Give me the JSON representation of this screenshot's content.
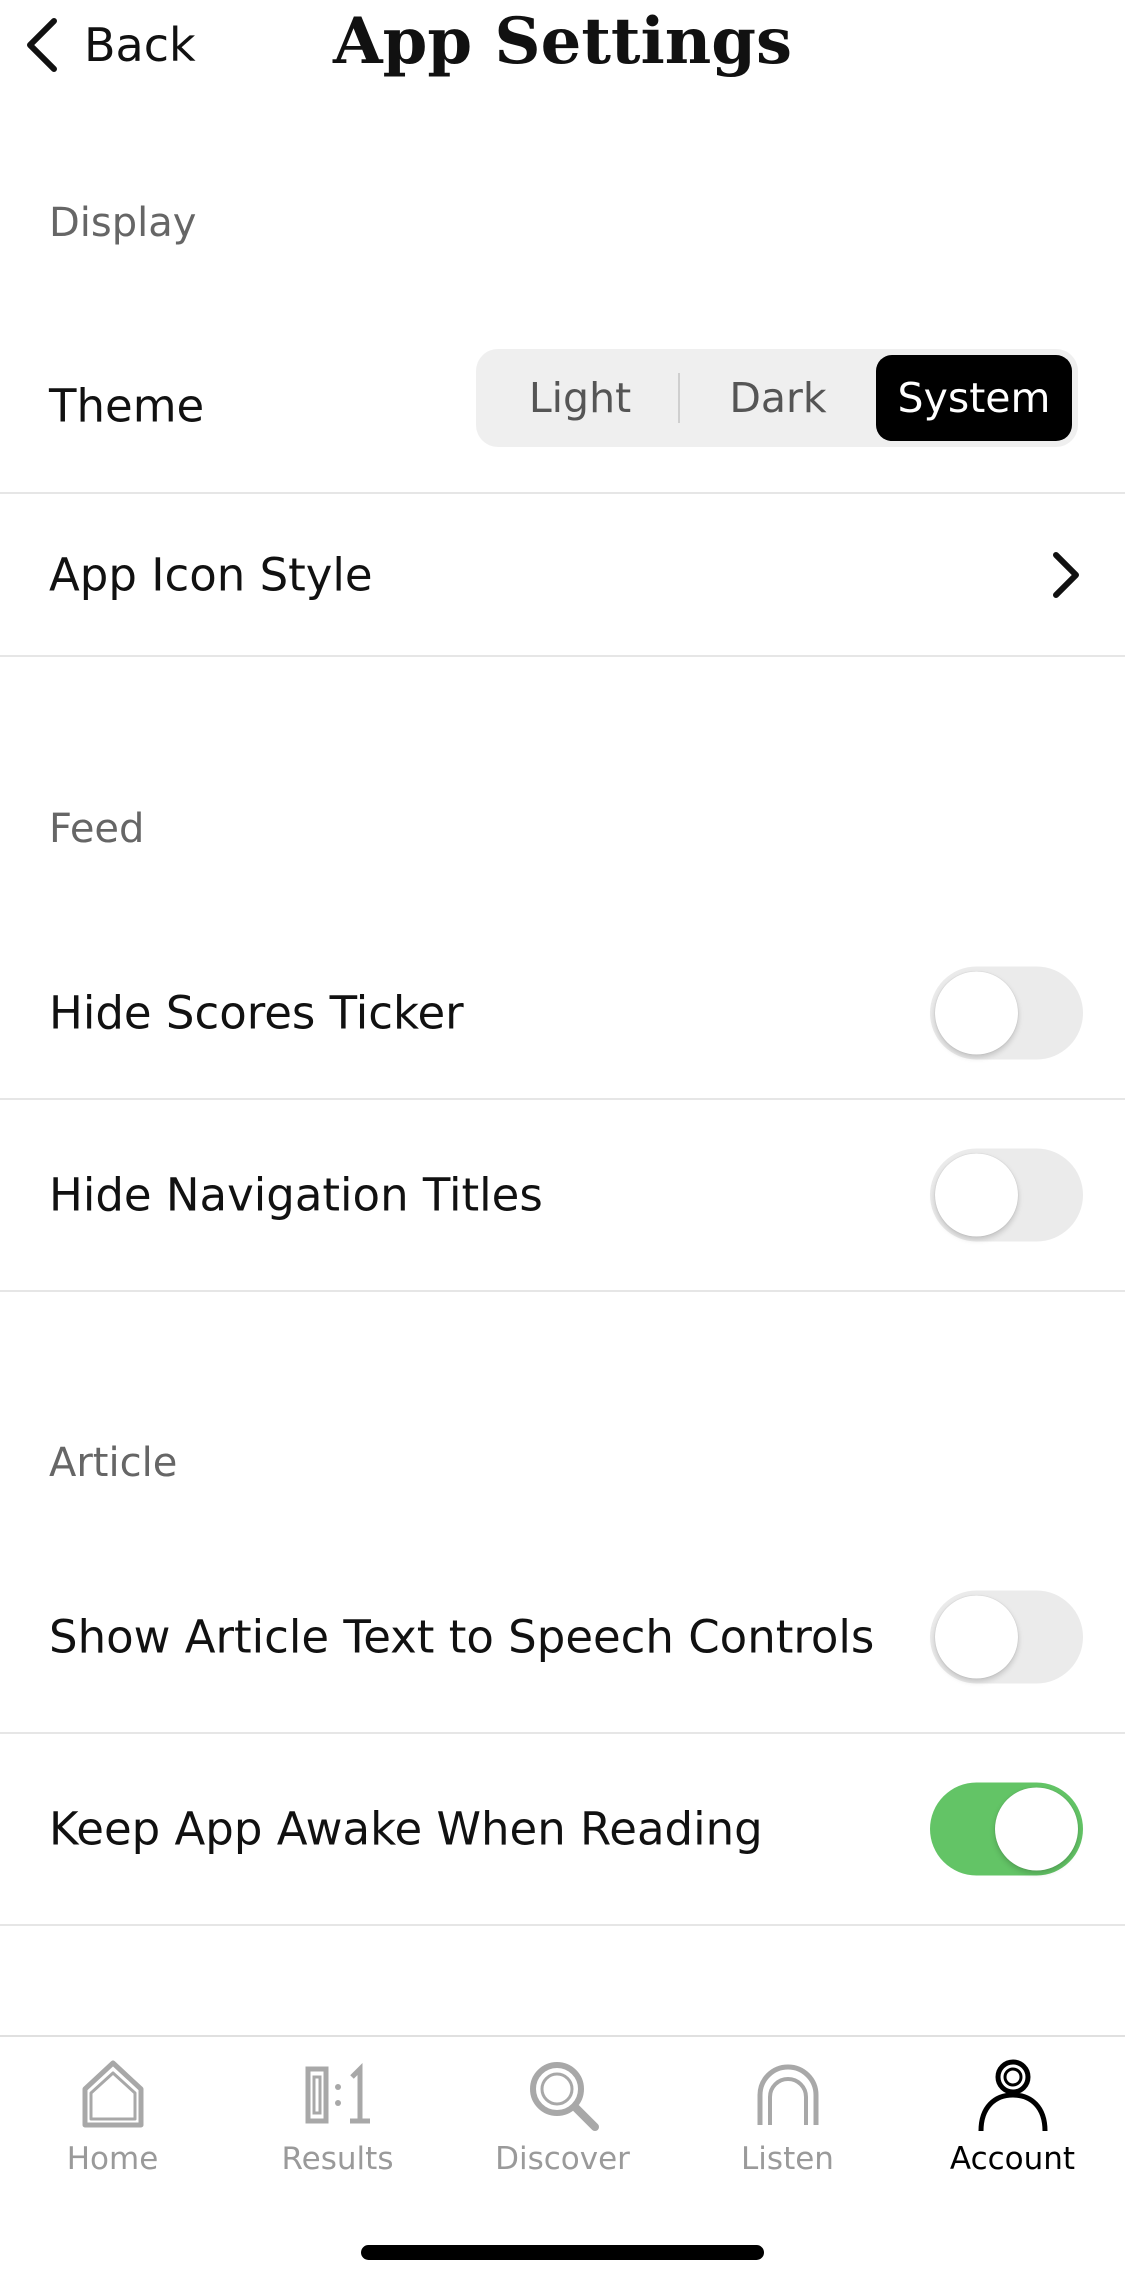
{
  "header": {
    "back_label": "Back",
    "title": "App Settings"
  },
  "sections": {
    "display": {
      "label": "Display",
      "theme": {
        "label": "Theme",
        "options": [
          "Light",
          "Dark",
          "System"
        ],
        "selected": "System"
      },
      "app_icon_style": {
        "label": "App Icon Style"
      }
    },
    "feed": {
      "label": "Feed",
      "hide_scores_ticker": {
        "label": "Hide Scores Ticker",
        "on": false
      },
      "hide_navigation_titles": {
        "label": "Hide Navigation Titles",
        "on": false
      }
    },
    "article": {
      "label": "Article",
      "text_to_speech": {
        "label": "Show Article Text to Speech Controls",
        "on": false
      },
      "keep_awake": {
        "label": "Keep App Awake When Reading",
        "on": true
      }
    }
  },
  "tab_bar": {
    "tabs": [
      {
        "label": "Home",
        "icon": "home-icon",
        "active": false
      },
      {
        "label": "Results",
        "icon": "results-icon",
        "active": false
      },
      {
        "label": "Discover",
        "icon": "discover-icon",
        "active": false
      },
      {
        "label": "Listen",
        "icon": "listen-icon",
        "active": false
      },
      {
        "label": "Account",
        "icon": "account-icon",
        "active": true
      }
    ]
  },
  "colors": {
    "toggle_on": "#63c466",
    "toggle_off": "#ebebeb",
    "segment_selected_bg": "#000000",
    "section_label": "#666666",
    "tab_inactive": "#9a9a9a"
  }
}
